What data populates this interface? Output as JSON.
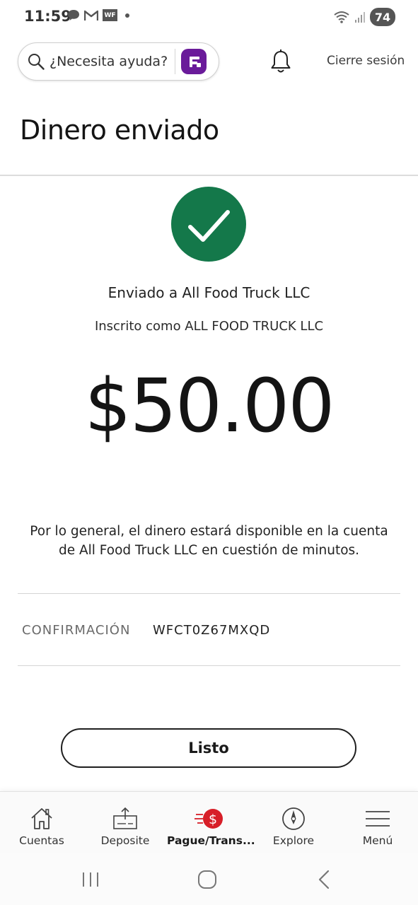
{
  "status_bar": {
    "time": "11:59",
    "wf_badge": "WF",
    "battery": "74"
  },
  "header": {
    "help_placeholder": "¿Necesita ayuda?",
    "sign_out": "Cierre sesión"
  },
  "page": {
    "title": "Dinero enviado"
  },
  "transfer": {
    "sent_to": "Enviado a All Food Truck LLC",
    "enrolled_as": "Inscrito como ALL FOOD TRUCK LLC",
    "amount": "$50.00",
    "availability_note": "Por lo general, el dinero estará disponible en la cuenta de All Food Truck LLC en cuestión de minutos.",
    "confirmation_label": "CONFIRMACIÓN",
    "confirmation_code": "WFCT0Z67MXQD",
    "done_button": "Listo"
  },
  "bottom_nav": {
    "items": [
      {
        "label": "Cuentas",
        "icon": "house-icon"
      },
      {
        "label": "Deposite",
        "icon": "deposit-icon"
      },
      {
        "label": "Pague/Trans...",
        "icon": "pay-transfer-icon",
        "active": true
      },
      {
        "label": "Explore",
        "icon": "compass-icon"
      },
      {
        "label": "Menú",
        "icon": "hamburger-menu-icon"
      }
    ]
  },
  "colors": {
    "success_green": "#14784a",
    "accent_red": "#d71e28",
    "fargo_purple": "#6a1b9a"
  }
}
